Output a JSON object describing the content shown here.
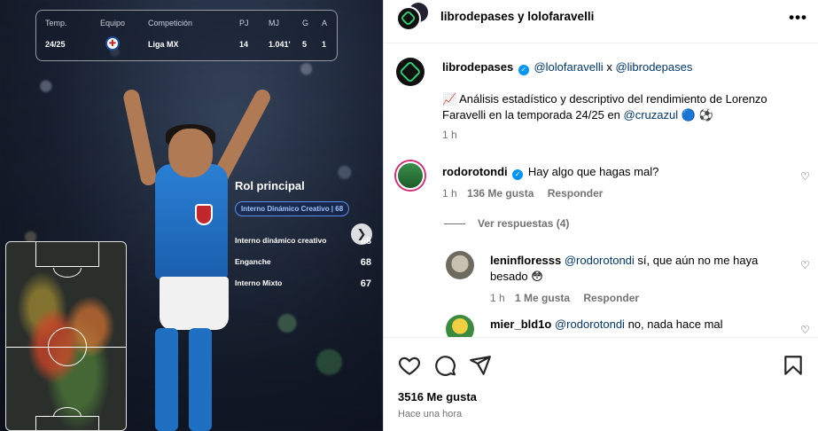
{
  "media": {
    "stats": {
      "headers": [
        "Temp.",
        "Equipo",
        "Competición",
        "PJ",
        "MJ",
        "G",
        "A"
      ],
      "season": "24/25",
      "competition": "Liga MX",
      "pj": "14",
      "mj": "1.041'",
      "g": "5",
      "a": "1"
    },
    "role": {
      "title": "Rol principal",
      "pill": "Interno Dinámico Creativo | 68",
      "rows": [
        {
          "label": "Interno dinámico creativo",
          "value": "68"
        },
        {
          "label": "Enganche",
          "value": "68"
        },
        {
          "label": "Interno Mixto",
          "value": "67"
        }
      ]
    }
  },
  "post": {
    "header_title": "librodepases y lolofaravelli",
    "caption": {
      "user": "librodepases",
      "mention1": "@lolofaravelli",
      "x": "x",
      "mention2": "@librodepases",
      "text_prefix": "📈 Análisis estadístico y descriptivo del rendimiento de Lorenzo Faravelli en la temporada 24/25 en",
      "text_mention": "@cruzazul",
      "text_suffix": "🔵 ⚽",
      "time": "1 h"
    },
    "comments": [
      {
        "user": "rodorotondi",
        "text": "Hay algo que hagas mal?",
        "time": "1 h",
        "likes": "136 Me gusta",
        "reply": "Responder"
      },
      {
        "user": "leninfloresss",
        "mention": "@rodorotondi",
        "text": "sí, que aún no me haya besado 😳",
        "time": "1 h",
        "likes": "1 Me gusta",
        "reply": "Responder"
      },
      {
        "user": "mier_bld1o",
        "mention": "@rodorotondi",
        "text": "no, nada hace mal"
      }
    ],
    "view_replies": "Ver respuestas (4)",
    "likes_count": "3516 Me gusta",
    "posted_ago": "Hace una hora"
  }
}
